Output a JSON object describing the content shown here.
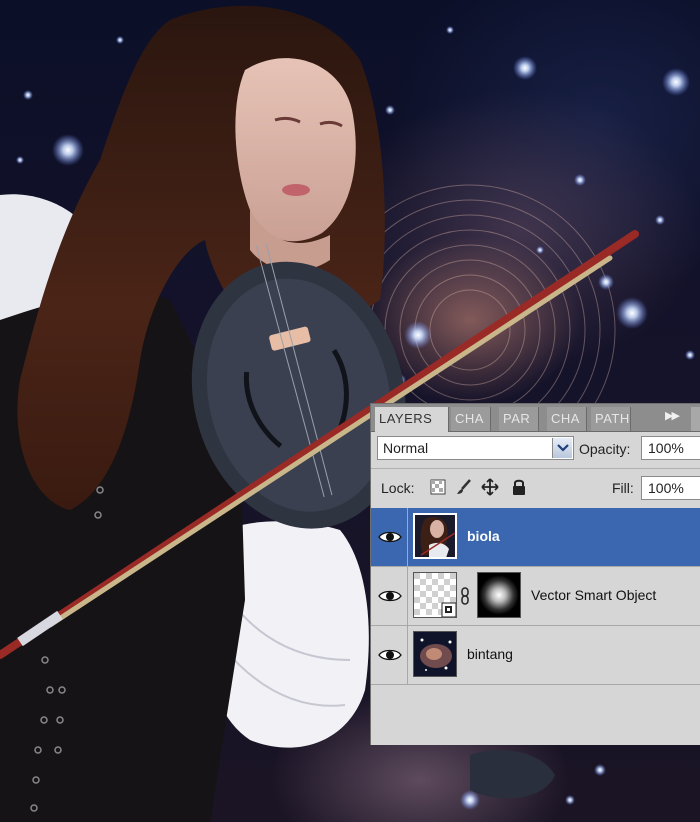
{
  "layers_panel": {
    "tabs": [
      {
        "label": "LAYERS",
        "active": true
      },
      {
        "label": "CHA",
        "active": false
      },
      {
        "label": "PAR",
        "active": false
      },
      {
        "label": "CHA",
        "active": false
      },
      {
        "label": "PATH",
        "active": false
      }
    ],
    "more_icon": "double-chevron-right-icon",
    "blend_mode": "Normal",
    "opacity_label": "Opacity:",
    "opacity_value": "100%",
    "lock_label": "Lock:",
    "lock_icons": [
      "lock-transparent-pixels-icon",
      "lock-image-pixels-icon",
      "lock-position-icon",
      "lock-all-icon"
    ],
    "fill_label": "Fill:",
    "fill_value": "100%",
    "layers": [
      {
        "name": "biola",
        "selected": true,
        "visible": true,
        "thumbnail": "violinist-photo"
      },
      {
        "name": "Vector Smart Object",
        "selected": false,
        "visible": true,
        "thumbnail": "transparent-with-smart-object-badge",
        "has_mask": true
      },
      {
        "name": "bintang",
        "selected": false,
        "visible": true,
        "thumbnail": "nebula-starfield"
      }
    ]
  },
  "colors": {
    "selected_row": "#3a67b0",
    "panel_bg": "#d6d6d6",
    "tab_bar": "#8d8d8d",
    "bow_red": "#9a2a26",
    "bow_hair": "#c9b68a"
  }
}
